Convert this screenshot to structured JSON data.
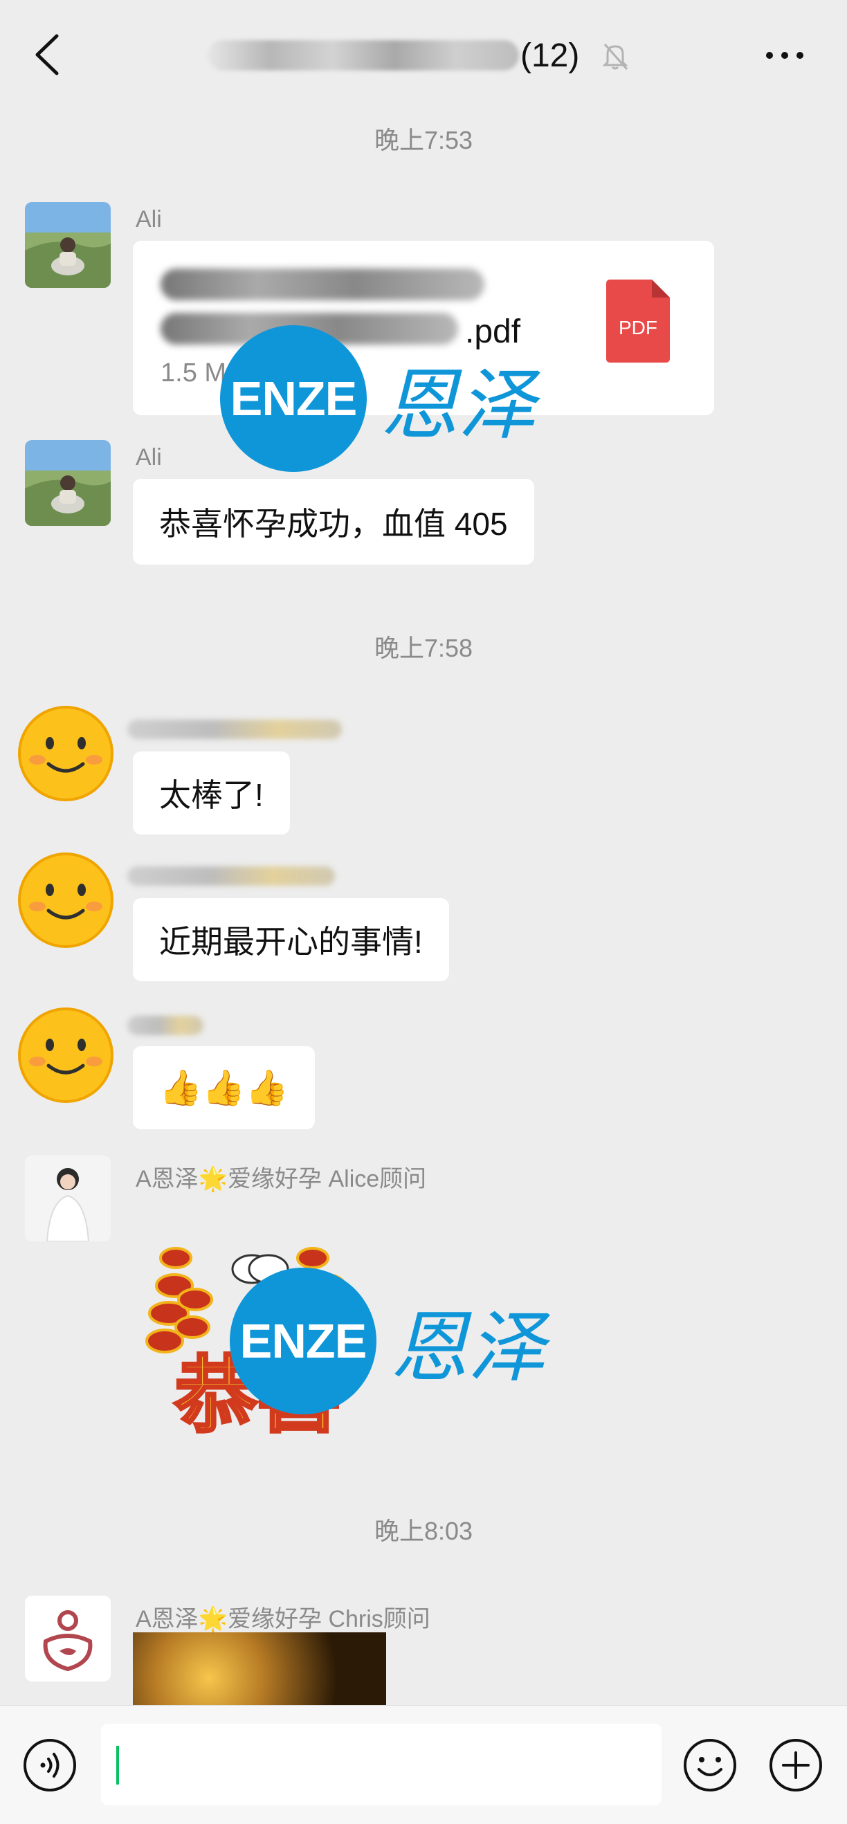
{
  "header": {
    "title_count": "(12)",
    "back_icon": "chevron-left-icon",
    "mute_icon": "bell-off-icon",
    "more_icon": "ellipsis-icon"
  },
  "timestamps": [
    "晚上7:53",
    "晚上7:58",
    "晚上8:03"
  ],
  "messages": [
    {
      "sender": "Ali",
      "type": "file",
      "file_ext": ".pdf",
      "file_size": "1.5 M",
      "file_icon_label": "PDF"
    },
    {
      "sender": "Ali",
      "type": "text",
      "text": "恭喜怀孕成功，血值 405"
    },
    {
      "type": "text",
      "text": "太棒了!"
    },
    {
      "type": "text",
      "text": "近期最开心的事情!"
    },
    {
      "type": "text",
      "text": "👍👍👍"
    },
    {
      "sender": "A恩泽🌟爱缘好孕 Alice顾问",
      "type": "sticker",
      "sticker_text": "恭喜"
    },
    {
      "sender": "A恩泽🌟爱缘好孕 Chris顾问",
      "type": "image"
    }
  ],
  "watermark": {
    "latin": "ENZE",
    "chinese": "恩泽"
  },
  "colors": {
    "background": "#ededed",
    "bubble": "#ffffff",
    "watermark_blue": "#0f96d9",
    "pdf_red": "#e84a4a",
    "cursor_green": "#07c160"
  },
  "input_bar": {
    "voice_icon": "voice-icon",
    "emoji_icon": "smiley-icon",
    "plus_icon": "plus-circle-icon"
  }
}
